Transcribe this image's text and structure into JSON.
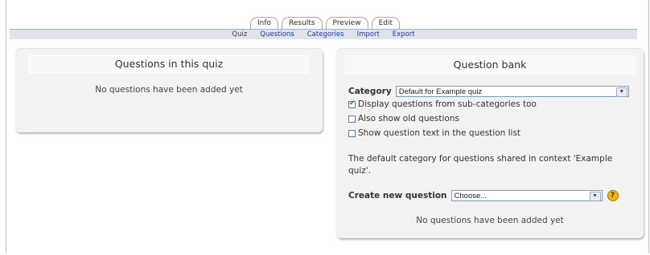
{
  "tabs": [
    {
      "label": "Info"
    },
    {
      "label": "Results"
    },
    {
      "label": "Preview"
    },
    {
      "label": "Edit"
    }
  ],
  "subnav": {
    "current": "Quiz",
    "links": [
      "Questions",
      "Categories",
      "Import",
      "Export"
    ]
  },
  "left_panel": {
    "title": "Questions in this quiz",
    "empty_message": "No questions have been added yet"
  },
  "right_panel": {
    "title": "Question bank",
    "category_label": "Category",
    "category_value": "Default for Example quiz",
    "checkboxes": [
      {
        "label": "Display questions from sub-categories too",
        "checked": true
      },
      {
        "label": "Also show old questions",
        "checked": false
      },
      {
        "label": "Show question text in the question list",
        "checked": false
      }
    ],
    "context_text": "The default category for questions shared in context 'Example quiz'.",
    "create_label": "Create new question",
    "create_value": "Choose...",
    "help_glyph": "?",
    "empty_message": "No questions have been added yet"
  },
  "icons": {
    "dropdown": "chevron-down-icon",
    "help": "help-icon"
  },
  "colors": {
    "link": "#1b3b94",
    "subnav_bg": "#dfe4ec",
    "box_bg": "#f2f2f2"
  }
}
